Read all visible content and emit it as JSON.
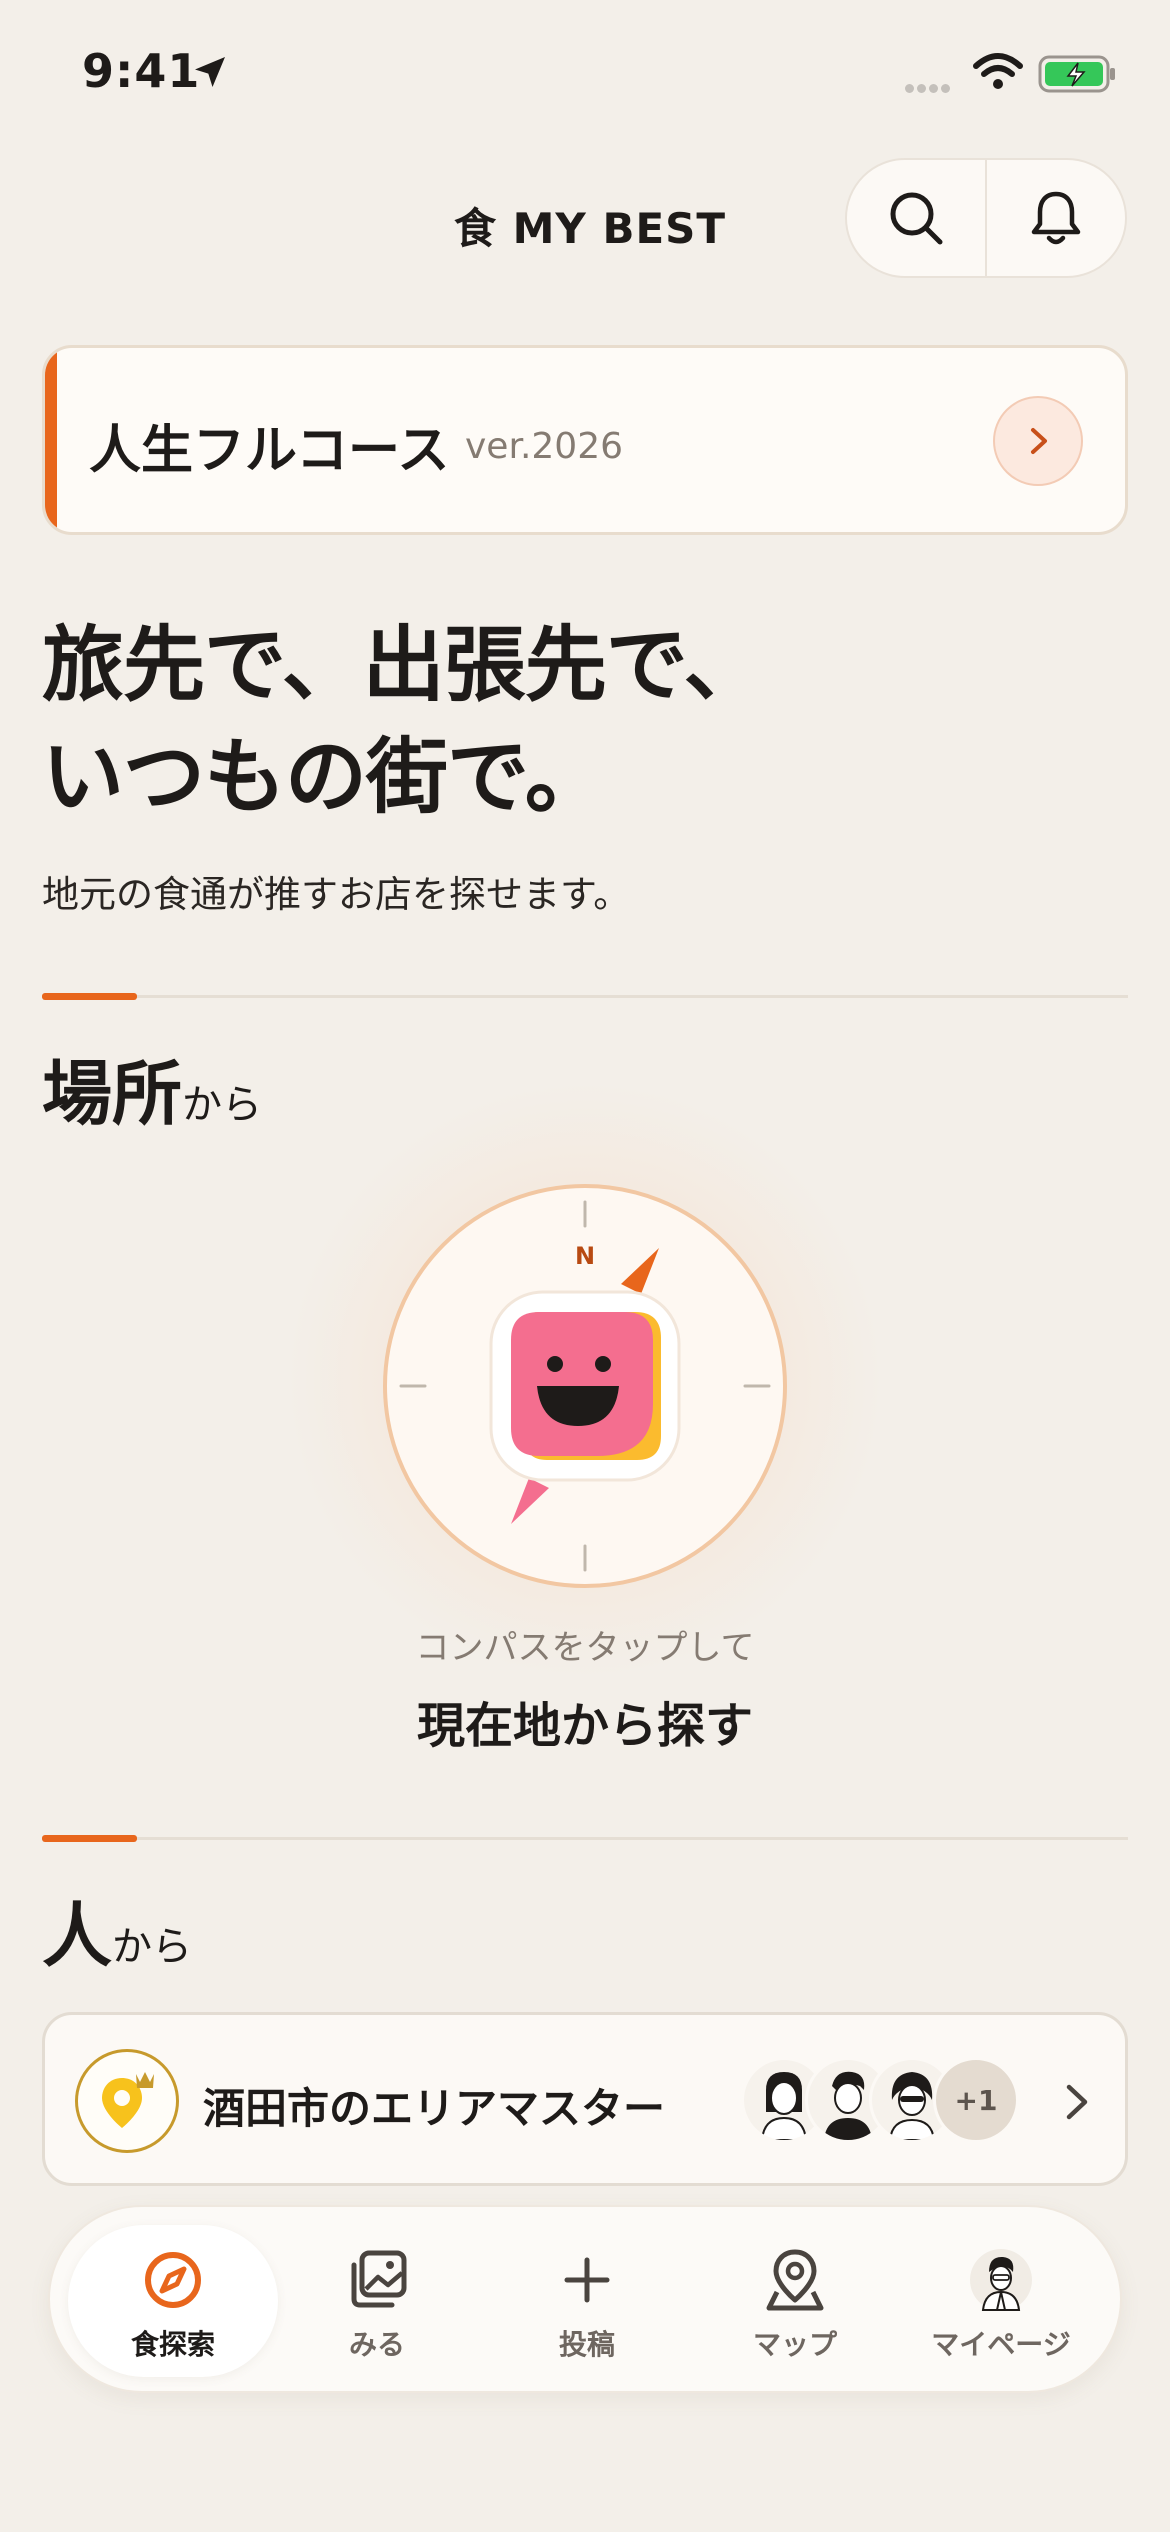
{
  "status_bar": {
    "time": "9:41"
  },
  "header": {
    "logo": "食 MY BEST"
  },
  "course_card": {
    "title": "人生フルコース",
    "version": "ver.2026"
  },
  "hero": {
    "headline_line1": "旅先で、出張先で、",
    "headline_line2": "いつもの街で。",
    "subtitle": "地元の食通が推すお店を探せます。"
  },
  "section_place": {
    "title": "場所",
    "suffix": "から"
  },
  "compass": {
    "north_label": "N",
    "hint": "コンパスをタップして",
    "cta": "現在地から探す"
  },
  "section_people": {
    "title": "人",
    "suffix": "から"
  },
  "area_master": {
    "title": "酒田市のエリアマスター",
    "more_count": "+1"
  },
  "tab_bar": {
    "tabs": [
      {
        "label": "食探索",
        "icon": "compass-icon",
        "active": true
      },
      {
        "label": "みる",
        "icon": "gallery-icon",
        "active": false
      },
      {
        "label": "投稿",
        "icon": "plus-icon",
        "active": false
      },
      {
        "label": "マップ",
        "icon": "map-pin-icon",
        "active": false
      },
      {
        "label": "マイページ",
        "icon": "avatar-icon",
        "active": false
      }
    ]
  },
  "colors": {
    "accent": "#E8661C",
    "background": "#F3EFE9",
    "mascot_pink": "#F46E8F",
    "mascot_yellow": "#FBBB2E"
  }
}
